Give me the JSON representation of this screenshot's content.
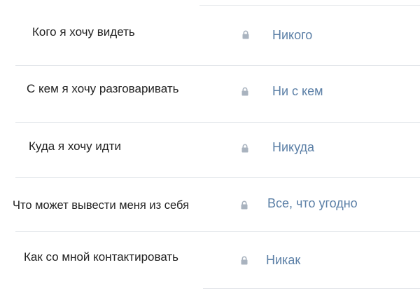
{
  "privacy_settings": {
    "colors": {
      "label": "#222222",
      "value_link": "#5b7fa6",
      "lock_icon": "#a9b3bf",
      "divider": "#e3e6ea"
    },
    "rows": [
      {
        "label": "Кого я хочу видеть",
        "icon": "lock-icon",
        "value": "Никого"
      },
      {
        "label": "С кем я хочу разговаривать",
        "icon": "lock-icon",
        "value": "Ни с кем"
      },
      {
        "label": "Куда я хочу идти",
        "icon": "lock-icon",
        "value": "Никуда"
      },
      {
        "label": "Что может вывести меня из себя",
        "icon": "lock-icon",
        "value": "Все, что угодно"
      },
      {
        "label": "Как со мной контактировать",
        "icon": "lock-icon",
        "value": "Никак"
      }
    ]
  }
}
